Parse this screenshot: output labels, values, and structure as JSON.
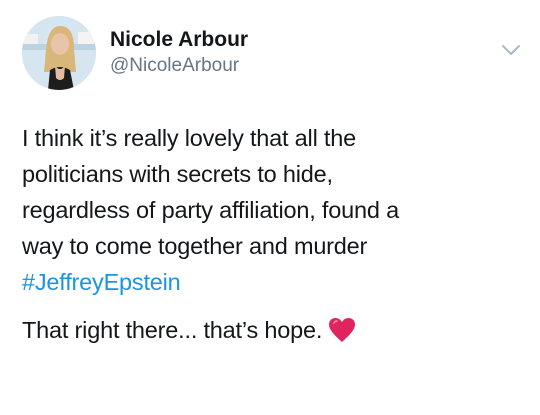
{
  "tweet": {
    "author": {
      "display_name": "Nicole Arbour",
      "handle": "@NicoleArbour"
    },
    "menu_icon": "chevron-down-icon",
    "body_lines": [
      "I think it’s really lovely that all the",
      "politicians with secrets to hide,",
      "regardless of party affiliation, found a",
      "way to come together and murder"
    ],
    "hashtag": "#JeffreyEpstein",
    "closing_text": "That right there... that’s hope.",
    "emoji": "heart-icon"
  },
  "colors": {
    "text": "#14171a",
    "handle": "#657786",
    "link": "#1b95e0",
    "heart": "#e0245e",
    "chevron": "#aab8c2"
  }
}
